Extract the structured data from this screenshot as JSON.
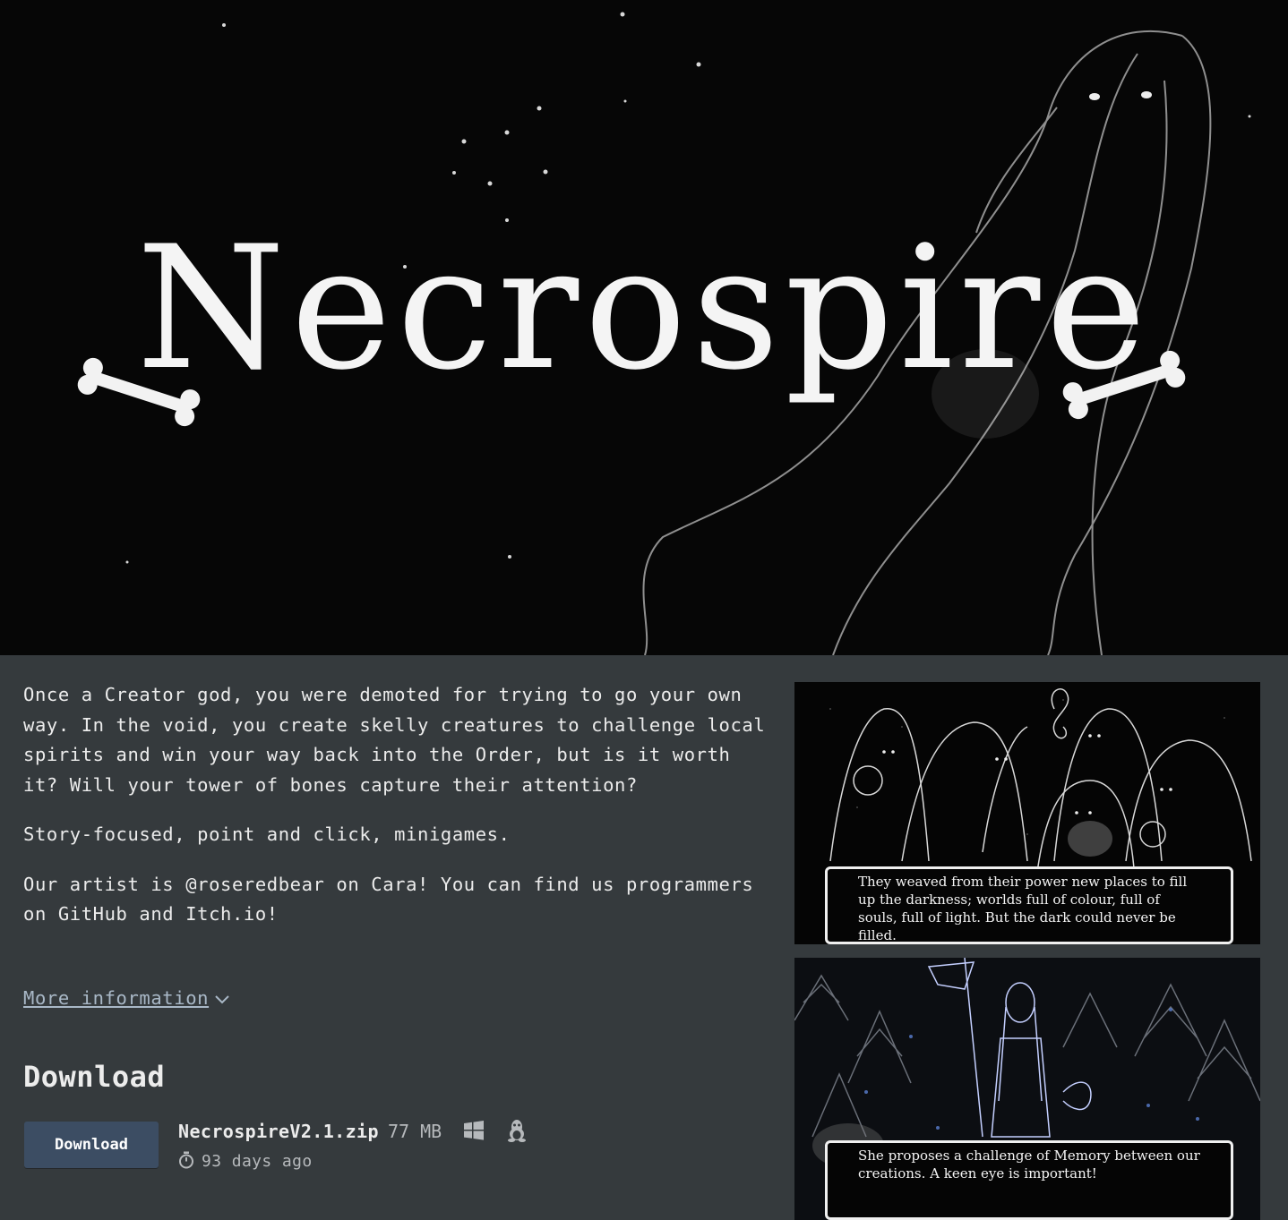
{
  "banner": {
    "title": "Necrospire"
  },
  "description": {
    "paragraphs": [
      "Once a Creator god, you were demoted for trying to go your own way. In the void, you create skelly creatures to challenge local spirits and win your way back into the Order, but is it worth it? Will your tower of bones capture their attention?",
      "Story-focused, point and click, minigames.",
      "Our artist is @roseredbear on Cara! You can find us programmers on GitHub and Itch.io!"
    ]
  },
  "more_info": {
    "label": "More information"
  },
  "download": {
    "heading": "Download",
    "button_label": "Download",
    "file_name": "NecrospireV2.1.zip",
    "file_size": "77 MB",
    "platforms": [
      "windows-icon",
      "linux-icon"
    ],
    "date": "93 days ago"
  },
  "screenshots": [
    {
      "caption": "They weaved from their power new places to fill up the darkness; worlds full of colour, full of souls, full of light. But the dark could never be filled."
    },
    {
      "caption": "She proposes a challenge of Memory between our creations. A keen eye is important!"
    }
  ],
  "colors": {
    "page_bg": "#353a3d",
    "button_bg": "#3c4d63",
    "link": "#a9b8c7"
  }
}
